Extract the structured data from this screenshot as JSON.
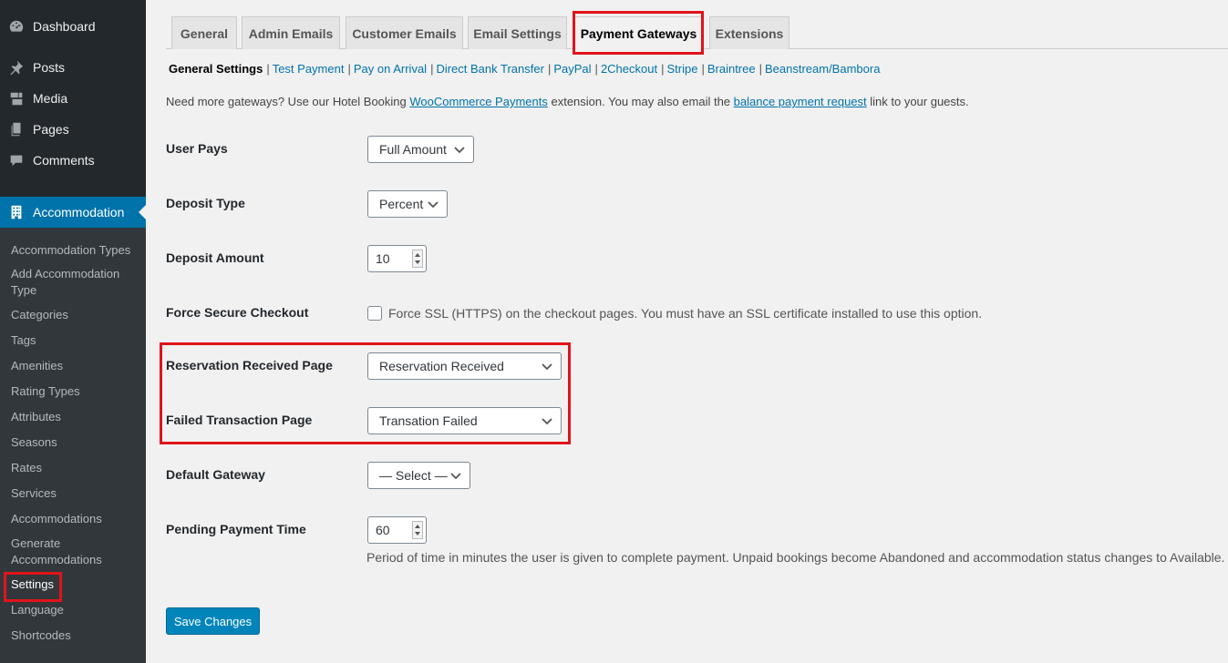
{
  "sidebar": {
    "top_items": [
      {
        "label": "Dashboard",
        "icon": "dashboard-icon"
      },
      {
        "label": "Posts",
        "icon": "pin-icon"
      },
      {
        "label": "Media",
        "icon": "media-icon"
      },
      {
        "label": "Pages",
        "icon": "pages-icon"
      },
      {
        "label": "Comments",
        "icon": "comments-icon"
      }
    ],
    "current": {
      "label": "Accommodation",
      "icon": "building-icon"
    },
    "submenu": [
      "Accommodation Types",
      "Add Accommodation Type",
      "Categories",
      "Tags",
      "Amenities",
      "Rating Types",
      "Attributes",
      "Seasons",
      "Rates",
      "Services",
      "Accommodations",
      "Generate Accommodations",
      "Settings",
      "Language",
      "Shortcodes"
    ]
  },
  "tabs": [
    "General",
    "Admin Emails",
    "Customer Emails",
    "Email Settings",
    "Payment Gateways",
    "Extensions"
  ],
  "active_tab": "Payment Gateways",
  "subnav": {
    "current": "General Settings",
    "links": [
      "Test Payment",
      "Pay on Arrival",
      "Direct Bank Transfer",
      "PayPal",
      "2Checkout",
      "Stripe",
      "Braintree",
      "Beanstream/Bambora"
    ]
  },
  "intro": {
    "part1": "Need more gateways? Use our Hotel Booking ",
    "link1": "WooCommerce Payments",
    "part2": " extension. You may also email the ",
    "link2": "balance payment request",
    "part3": " link to your guests."
  },
  "form": {
    "user_pays": {
      "label": "User Pays",
      "value": "Full Amount"
    },
    "deposit_type": {
      "label": "Deposit Type",
      "value": "Percent"
    },
    "deposit_amount": {
      "label": "Deposit Amount",
      "value": "10"
    },
    "force_secure": {
      "label": "Force Secure Checkout",
      "checkbox_label": "Force SSL (HTTPS) on the checkout pages. You must have an SSL certificate installed to use this option.",
      "checked": false
    },
    "reservation_received": {
      "label": "Reservation Received Page",
      "value": "Reservation Received"
    },
    "failed_transaction": {
      "label": "Failed Transaction Page",
      "value": "Transation Failed"
    },
    "default_gateway": {
      "label": "Default Gateway",
      "value": "— Select —"
    },
    "pending_time": {
      "label": "Pending Payment Time",
      "value": "60",
      "description": "Period of time in minutes the user is given to complete payment. Unpaid bookings become Abandoned and accommodation status changes to Available."
    }
  },
  "save_label": "Save Changes",
  "colors": {
    "sidebar": "#23282d",
    "accent": "#0073aa",
    "highlight": "#e0141a"
  }
}
